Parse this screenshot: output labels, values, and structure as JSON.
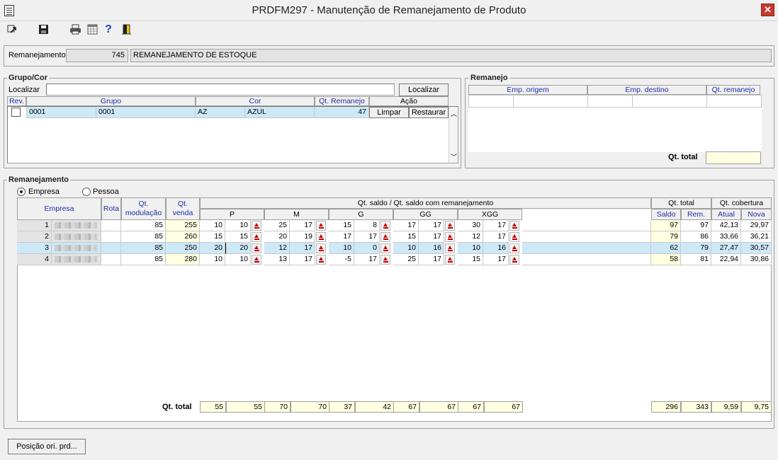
{
  "window": {
    "title": "PRDFM297 - Manutenção de Remanejamento de Produto",
    "close": "✕"
  },
  "toolbar": {
    "icons": [
      "exit-icon",
      "save-icon",
      "print-icon",
      "calendar-icon",
      "help-icon",
      "door-icon"
    ],
    "help_glyph": "?"
  },
  "header": {
    "label": "Remanejamento",
    "number": "745",
    "description": "REMANEJAMENTO DE ESTOQUE"
  },
  "grupo_cor": {
    "title": "Grupo/Cor",
    "localizar_label": "Localizar",
    "localizar_value": "",
    "localizar_button": "Localizar",
    "columns": {
      "rev": "Rev.",
      "grupo": "Grupo",
      "cor": "Cor",
      "qt_remanejo": "Qt. Remanejo",
      "acao": "Ação"
    },
    "row": {
      "grupo_code": "0001",
      "grupo_name": "0001",
      "cor_code": "AZ",
      "cor_name": "AZUL",
      "qt": "47",
      "limpar": "Limpar",
      "restaurar": "Restaurar"
    }
  },
  "remanejo": {
    "title": "Remanejo",
    "columns": {
      "origem": "Emp. origem",
      "destino": "Emp. destino",
      "qt": "Qt. remanejo"
    },
    "total_label": "Qt. total",
    "total_value": ""
  },
  "remanejamento": {
    "title": "Remanejamento",
    "radio_empresa": "Empresa",
    "radio_pessoa": "Pessoa",
    "selected": "Empresa",
    "headers": {
      "empresa": "Empresa",
      "rota": "Rota",
      "qt_mod_1": "Qt.",
      "qt_mod_2": "modulação",
      "qt_venda_1": "Qt.",
      "qt_venda_2": "venda",
      "saldo_group": "Qt. saldo / Qt. saldo com remanejamento",
      "sizes": [
        "P",
        "M",
        "G",
        "GG",
        "XGG"
      ],
      "qt_total": "Qt. total",
      "qt_cobertura": "Qt. cobertura",
      "saldo": "Saldo",
      "rem": "Rem.",
      "atual": "Atual",
      "nova": "Nova"
    },
    "rows": [
      {
        "n": "1",
        "mod": "85",
        "venda": "255",
        "sizes": [
          [
            "10",
            "10"
          ],
          [
            "25",
            "17"
          ],
          [
            "15",
            "8"
          ],
          [
            "17",
            "17"
          ],
          [
            "30",
            "17"
          ]
        ],
        "saldo": "97",
        "rem": "97",
        "atual": "42,13",
        "nova": "29,97"
      },
      {
        "n": "2",
        "mod": "85",
        "venda": "260",
        "sizes": [
          [
            "15",
            "15"
          ],
          [
            "20",
            "19"
          ],
          [
            "17",
            "17"
          ],
          [
            "15",
            "17"
          ],
          [
            "12",
            "17"
          ]
        ],
        "saldo": "79",
        "rem": "86",
        "atual": "33,66",
        "nova": "36,21"
      },
      {
        "n": "3",
        "mod": "85",
        "venda": "250",
        "sizes": [
          [
            "20",
            "20"
          ],
          [
            "12",
            "17"
          ],
          [
            "10",
            "0"
          ],
          [
            "10",
            "16"
          ],
          [
            "10",
            "16"
          ]
        ],
        "saldo": "62",
        "rem": "79",
        "atual": "27,47",
        "nova": "30,57"
      },
      {
        "n": "4",
        "mod": "85",
        "venda": "280",
        "sizes": [
          [
            "10",
            "10"
          ],
          [
            "13",
            "17"
          ],
          [
            "-5",
            "17"
          ],
          [
            "25",
            "17"
          ],
          [
            "15",
            "17"
          ]
        ],
        "saldo": "58",
        "rem": "81",
        "atual": "22,94",
        "nova": "30,86"
      }
    ],
    "totals": {
      "label": "Qt. total",
      "sizes": [
        [
          "55",
          "55"
        ],
        [
          "70",
          "70"
        ],
        [
          "37",
          "42"
        ],
        [
          "67",
          "67"
        ],
        [
          "67",
          "67"
        ]
      ],
      "saldo": "296",
      "rem": "343",
      "atual": "9,59",
      "nova": "9,75"
    }
  },
  "footer": {
    "posicao_button": "Posição ori. prd..."
  }
}
